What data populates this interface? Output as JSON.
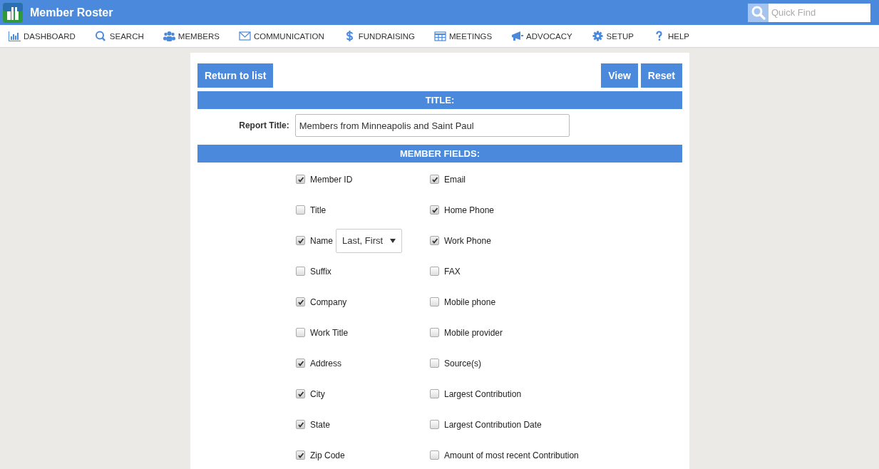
{
  "app": {
    "title": "Member Roster"
  },
  "quick_find": {
    "placeholder": "Quick Find"
  },
  "nav": [
    {
      "label": "DASHBOARD"
    },
    {
      "label": "SEARCH"
    },
    {
      "label": "MEMBERS"
    },
    {
      "label": "COMMUNICATION"
    },
    {
      "label": "FUNDRAISING"
    },
    {
      "label": "MEETINGS"
    },
    {
      "label": "ADVOCACY"
    },
    {
      "label": "SETUP"
    },
    {
      "label": "HELP"
    }
  ],
  "buttons": {
    "left": "Return to list",
    "right": [
      "View",
      "Reset"
    ]
  },
  "title_section": {
    "heading": "TITLE:",
    "label": "Report Title:",
    "value": "Members from Minneapolis and Saint Paul"
  },
  "fields_section": {
    "heading": "MEMBER FIELDS:",
    "rows": [
      {
        "left": {
          "label": "Member ID",
          "checked": true
        },
        "right": {
          "label": "Email",
          "checked": true
        }
      },
      {
        "left": {
          "label": "Title",
          "checked": false
        },
        "right": {
          "label": "Home Phone",
          "checked": true
        }
      },
      {
        "left": {
          "label": "Name",
          "checked": true,
          "select": "Last, First"
        },
        "right": {
          "label": "Work Phone",
          "checked": true
        }
      },
      {
        "left": {
          "label": "Suffix",
          "checked": false
        },
        "right": {
          "label": "FAX",
          "checked": false
        }
      },
      {
        "left": {
          "label": "Company",
          "checked": true
        },
        "right": {
          "label": "Mobile phone",
          "checked": false
        }
      },
      {
        "left": {
          "label": "Work Title",
          "checked": false
        },
        "right": {
          "label": "Mobile provider",
          "checked": false
        }
      },
      {
        "left": {
          "label": "Address",
          "checked": true
        },
        "right": {
          "label": "Source(s)",
          "checked": false
        }
      },
      {
        "left": {
          "label": "City",
          "checked": true
        },
        "right": {
          "label": "Largest Contribution",
          "checked": false
        }
      },
      {
        "left": {
          "label": "State",
          "checked": true
        },
        "right": {
          "label": "Largest Contribution Date",
          "checked": false
        }
      },
      {
        "left": {
          "label": "Zip Code",
          "checked": true
        },
        "right": {
          "label": "Amount of most recent Contribution",
          "checked": false
        }
      }
    ]
  }
}
